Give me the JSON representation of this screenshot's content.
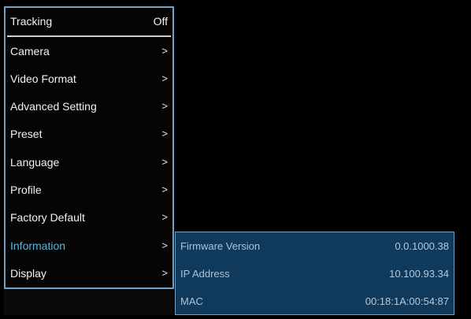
{
  "menu": {
    "header": {
      "label": "Tracking",
      "value": "Off"
    },
    "items": [
      {
        "label": "Camera",
        "arrow": ">"
      },
      {
        "label": "Video Format",
        "arrow": ">"
      },
      {
        "label": "Advanced Setting",
        "arrow": ">"
      },
      {
        "label": "Preset",
        "arrow": ">"
      },
      {
        "label": "Language",
        "arrow": ">"
      },
      {
        "label": "Profile",
        "arrow": ">"
      },
      {
        "label": "Factory Default",
        "arrow": ">"
      },
      {
        "label": "Information",
        "arrow": ">",
        "active": true
      },
      {
        "label": "Display",
        "arrow": ">"
      }
    ]
  },
  "information": {
    "rows": [
      {
        "label": "Firmware Version",
        "value": "0.0.1000.38"
      },
      {
        "label": "IP Address",
        "value": "10.100.93.34"
      },
      {
        "label": "MAC",
        "value": "00:18:1A:00:54:87"
      }
    ]
  },
  "colors": {
    "accent": "#5fb4dc",
    "border": "#6fa3c9",
    "panel": "#0f3a5c",
    "background": "#000000"
  }
}
